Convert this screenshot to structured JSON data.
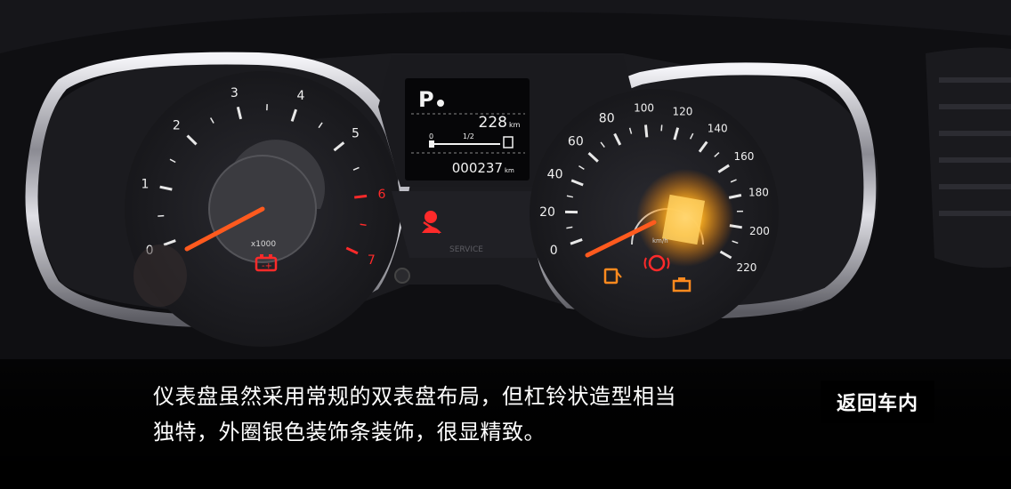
{
  "caption": {
    "line1": "仪表盘虽然采用常规的双表盘布局，但杠铃状造型相当",
    "line2": "独特，外圈银色装饰条装饰，很显精致。"
  },
  "back_button": {
    "label": "返回车内"
  },
  "photo": {
    "tachometer": {
      "ticks": [
        "0",
        "1",
        "2",
        "3",
        "4",
        "5",
        "6",
        "7"
      ],
      "unit": "x1000"
    },
    "display": {
      "gear": "P",
      "range_value": "228",
      "range_unit": "km",
      "scale_low": "0",
      "scale_mid": "1/2",
      "odometer_value": "000237",
      "odometer_unit": "km"
    },
    "speedometer": {
      "ticks": [
        "0",
        "20",
        "40",
        "60",
        "80",
        "100",
        "120",
        "140",
        "160",
        "180",
        "200",
        "220"
      ],
      "unit": "km/h"
    },
    "service_label": "SERVICE",
    "colors": {
      "needle": "#ff5a1e",
      "warning_red": "#ff2a2a",
      "fuel_amber": "#ff8a1e",
      "bezel": "#c9c9cf",
      "lcd": "#f2f2f2"
    }
  }
}
